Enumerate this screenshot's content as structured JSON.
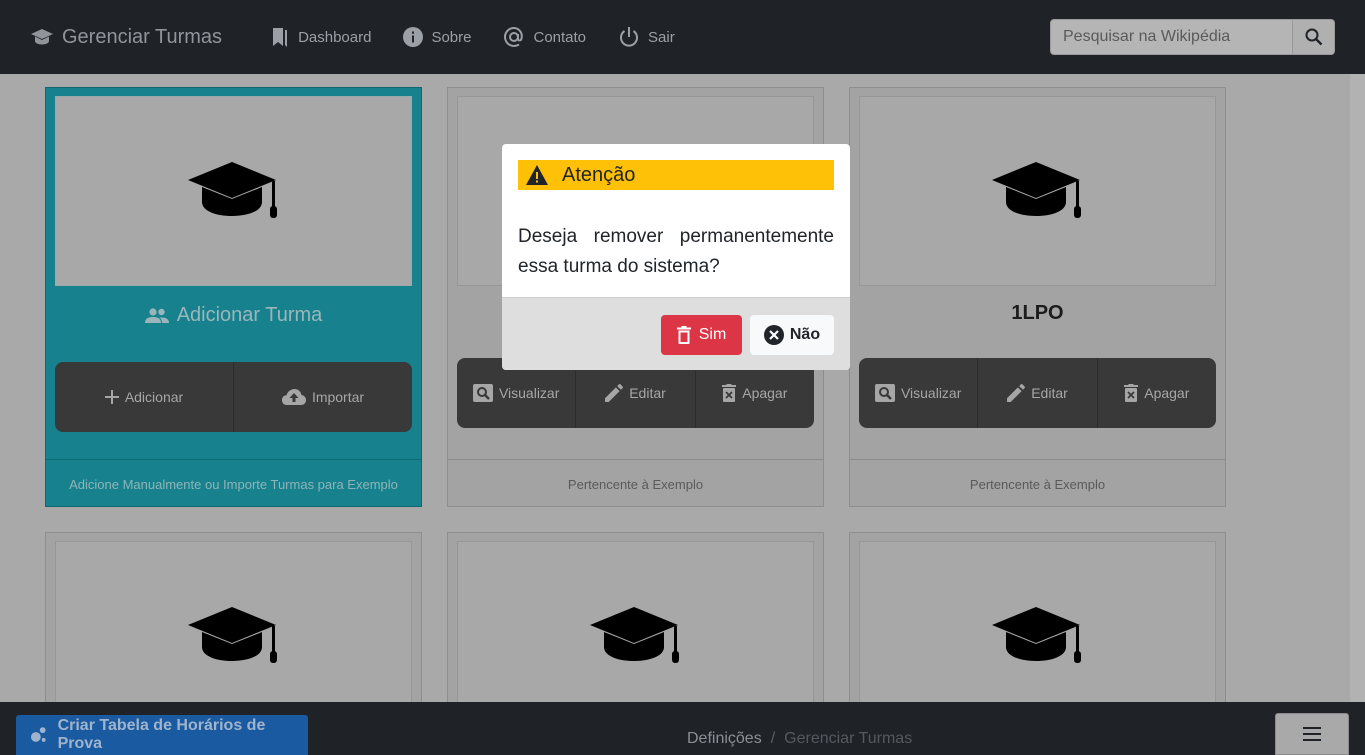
{
  "navbar": {
    "brand": "Gerenciar Turmas",
    "items": [
      {
        "label": "Dashboard",
        "icon": "bookmark-icon"
      },
      {
        "label": "Sobre",
        "icon": "info-icon"
      },
      {
        "label": "Contato",
        "icon": "at-icon"
      },
      {
        "label": "Sair",
        "icon": "power-icon"
      }
    ],
    "search_placeholder": "Pesquisar na Wikipédia"
  },
  "add_card": {
    "title": "Adicionar Turma",
    "buttons": [
      "Adicionar",
      "Importar"
    ],
    "footer": "Adicione Manualmente ou Importe Turmas para Exemplo"
  },
  "class_cards": [
    {
      "title": "",
      "buttons": [
        "Visualizar",
        "Editar",
        "Apagar"
      ],
      "footer": "Pertencente à Exemplo"
    },
    {
      "title": "1LPO",
      "buttons": [
        "Visualizar",
        "Editar",
        "Apagar"
      ],
      "footer": "Pertencente à Exemplo"
    }
  ],
  "modal": {
    "title": "Atenção",
    "message": "Deseja remover permanentemente essa turma do sistema?",
    "confirm": "Sim",
    "cancel": "Não"
  },
  "bottom": {
    "button": "Criar Tabela de Horários de Prova",
    "breadcrumb": [
      "Definições",
      "Gerenciar Turmas"
    ],
    "separator": "/"
  },
  "colors": {
    "navbar": "#1f2328",
    "teal_card": "#17828d",
    "warning": "#ffc107",
    "danger": "#dc3545",
    "primary": "#1a5aa0"
  }
}
